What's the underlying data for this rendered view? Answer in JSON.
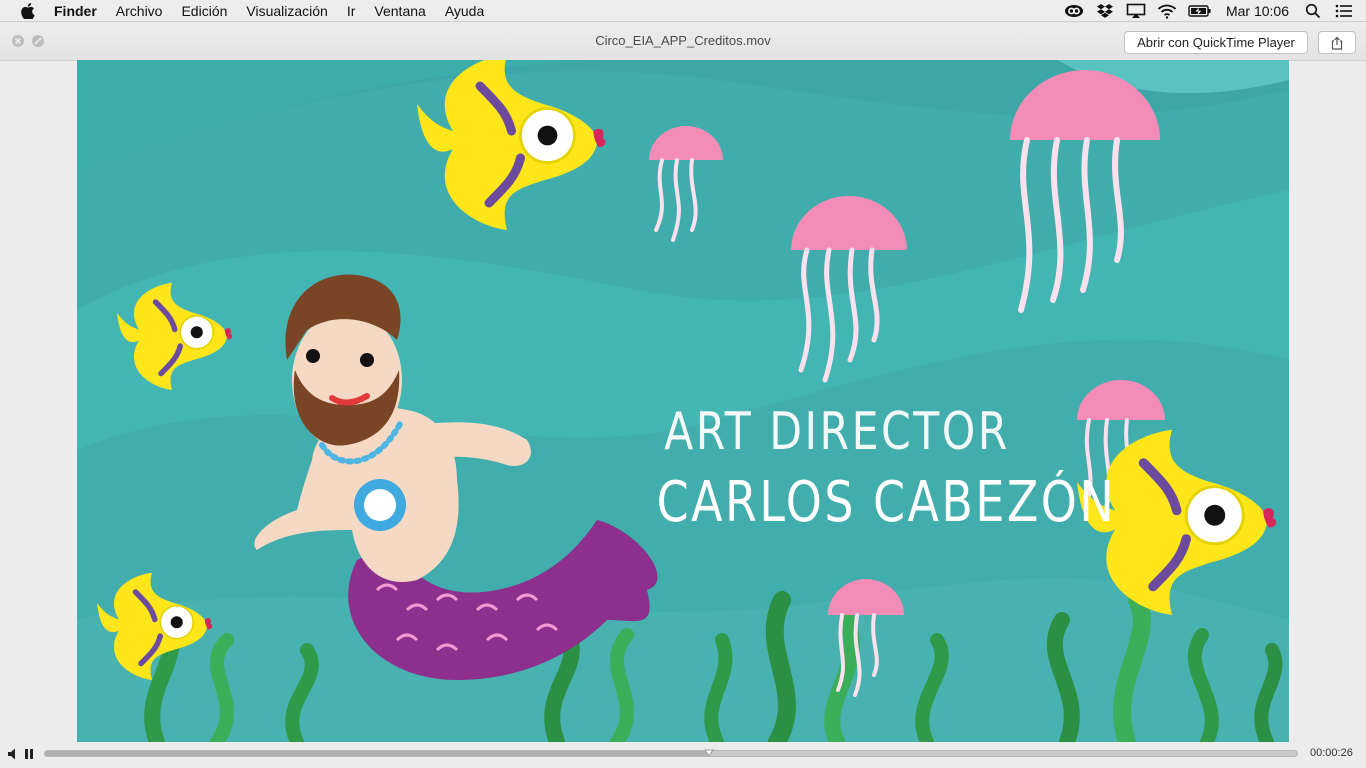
{
  "menubar": {
    "apple_icon": "apple-logo-icon",
    "items": [
      "Finder",
      "Archivo",
      "Edición",
      "Visualización",
      "Ir",
      "Ventana",
      "Ayuda"
    ],
    "status_icons": [
      "creative-cloud-icon",
      "dropbox-icon",
      "airplay-icon",
      "wifi-icon",
      "battery-icon"
    ],
    "clock": "Mar 10:06",
    "spotlight_icon": "search-icon",
    "notification_icon": "list-icon"
  },
  "window": {
    "title": "Circo_EIA_APP_Creditos.mov",
    "open_button_label": "Abrir con QuickTime Player",
    "share_icon": "share-icon"
  },
  "video": {
    "credit_role": "ART DIRECTOR",
    "credit_name": "CARLOS CABEZÓN",
    "colors": {
      "water": "#43b6b4",
      "fish": "#ffe61a",
      "jellyfish": "#f48cb8",
      "tail": "#8d2f8c",
      "seaweed": "#2e9a4a"
    }
  },
  "controls": {
    "volume_icon": "volume-icon",
    "pause_icon": "pause-icon",
    "progress": 0.53,
    "time": "00:00:26"
  }
}
